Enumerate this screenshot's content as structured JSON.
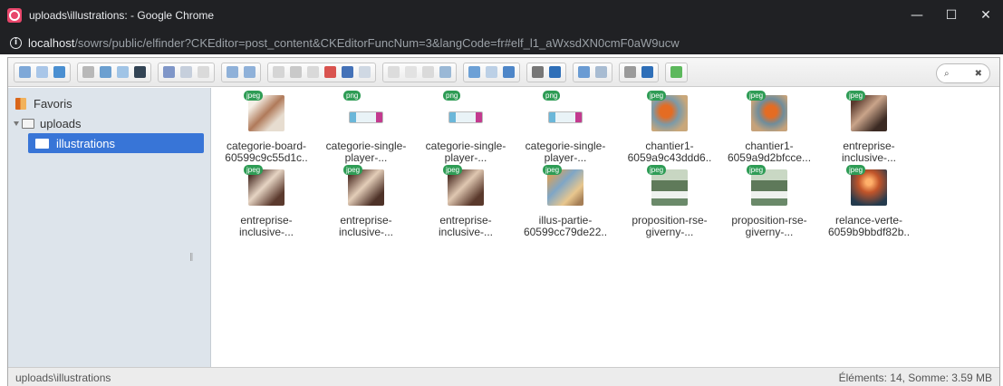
{
  "window": {
    "title": "uploads\\illustrations: - Google Chrome",
    "controls": {
      "minimize": "—",
      "maximize": "☐",
      "close": "✕"
    }
  },
  "addressbar": {
    "host": "localhost",
    "path": "/sowrs/public/elfinder?CKEditor=post_content&CKEditorFuncNum=3&langCode=fr#elf_l1_aWxsdXN0cmF0aW9ucw"
  },
  "search": {
    "icon": "search-icon",
    "clear": "✖"
  },
  "nav": {
    "favorites": "Favoris",
    "root": "uploads",
    "current": "illustrations"
  },
  "files": [
    {
      "name1": "categorie-board-",
      "name2": "60599c9c55d1c..",
      "type": "jpeg"
    },
    {
      "name1": "categorie-single-",
      "name2": "player-...",
      "type": "png"
    },
    {
      "name1": "categorie-single-",
      "name2": "player-...",
      "type": "png"
    },
    {
      "name1": "categorie-single-",
      "name2": "player-...",
      "type": "png"
    },
    {
      "name1": "chantier1-",
      "name2": "6059a9c43ddd6..",
      "type": "jpeg"
    },
    {
      "name1": "chantier1-",
      "name2": "6059a9d2bfcce...",
      "type": "jpeg"
    },
    {
      "name1": "entreprise-",
      "name2": "inclusive-...",
      "type": "jpeg"
    },
    {
      "name1": "entreprise-",
      "name2": "inclusive-...",
      "type": "jpeg"
    },
    {
      "name1": "entreprise-",
      "name2": "inclusive-...",
      "type": "jpeg"
    },
    {
      "name1": "entreprise-",
      "name2": "inclusive-...",
      "type": "jpeg"
    },
    {
      "name1": "illus-partie-",
      "name2": "60599cc79de22..",
      "type": "jpeg"
    },
    {
      "name1": "proposition-rse-",
      "name2": "giverny-...",
      "type": "jpeg"
    },
    {
      "name1": "proposition-rse-",
      "name2": "giverny-...",
      "type": "jpeg"
    },
    {
      "name1": "relance-verte-",
      "name2": "6059b9bbdf82b..",
      "type": "jpeg"
    }
  ],
  "status": {
    "path": "uploads\\illustrations",
    "summary": "Éléments: 14, Somme: 3.59 MB"
  },
  "colors": {
    "selection": "#3875d7",
    "badge": "#2e9c55",
    "navbar": "#dde4eb"
  }
}
